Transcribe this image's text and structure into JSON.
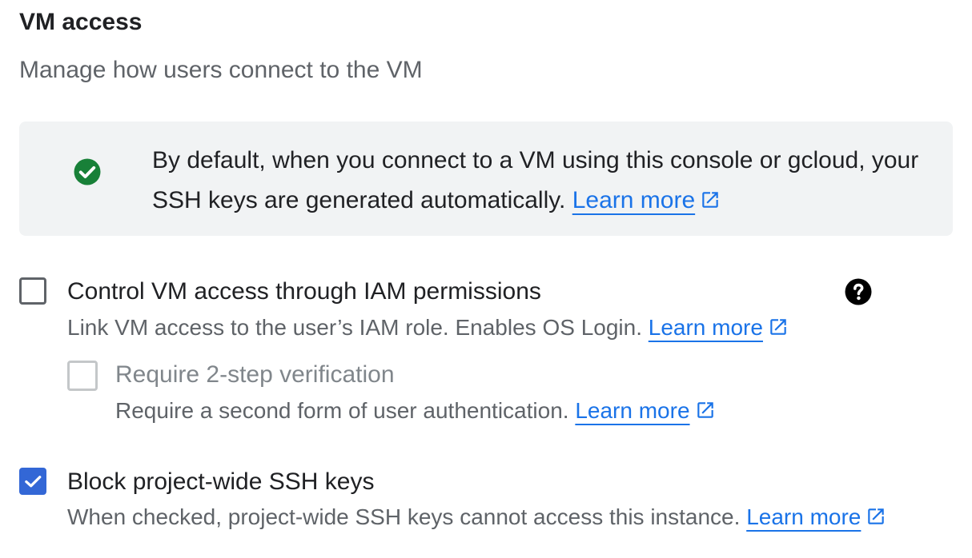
{
  "section": {
    "title": "VM access",
    "subtitle": "Manage how users connect to the VM"
  },
  "info": {
    "icon": "check-circle-icon",
    "text": "By default, when you connect to a VM using this console or gcloud, your SSH keys are generated automatically.",
    "link_label": "Learn more"
  },
  "options": [
    {
      "label": "Control VM access through IAM permissions",
      "description": "Link VM access to the user’s IAM role. Enables OS Login.",
      "link_label": "Learn more",
      "checked": false,
      "disabled": false,
      "help_icon": "help-icon"
    },
    {
      "label": "Require 2-step verification",
      "description": "Require a second form of user authentication.",
      "link_label": "Learn more",
      "checked": false,
      "disabled": true
    },
    {
      "label": "Block project-wide SSH keys",
      "description": "When checked, project-wide SSH keys cannot access this instance.",
      "link_label": "Learn more",
      "checked": true,
      "disabled": false
    }
  ],
  "colors": {
    "accent": "#1a73e8",
    "checkbox_checked": "#3367d6",
    "success": "#188038",
    "info_background": "#f1f3f4"
  }
}
